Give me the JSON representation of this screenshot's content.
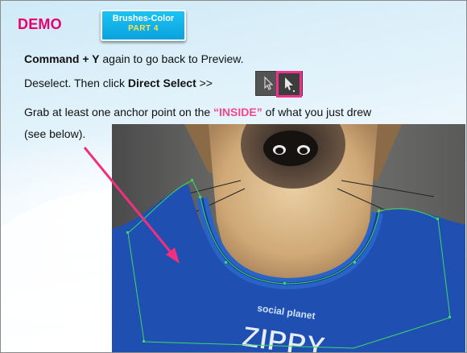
{
  "header": {
    "title": "DEMO",
    "badge_line1": "Brushes-Color",
    "badge_line2": "PART 4"
  },
  "instructions": {
    "line1_bold": "Command + Y",
    "line1_rest": " again to go back to Preview.",
    "line2_pre": "Deselect. Then click ",
    "line2_bold": "Direct Select",
    "line2_post": " >>",
    "line3_pre": "Grab at least one anchor point on the ",
    "line3_highlight": "“INSIDE”",
    "line3_post": " of what you just drew",
    "line4": "(see below)."
  },
  "tools": [
    {
      "name": "selection-tool",
      "icon": "arrow-outline-icon"
    },
    {
      "name": "direct-selection-tool",
      "icon": "arrow-filled-icon",
      "highlighted": true
    }
  ],
  "photo_text": {
    "line1": "social planet",
    "line2": "ZIPPY"
  },
  "colors": {
    "title": "#e8006d",
    "highlight": "#f3468c",
    "badge": "#0aa2df",
    "bandana": "#1f4fb0"
  }
}
